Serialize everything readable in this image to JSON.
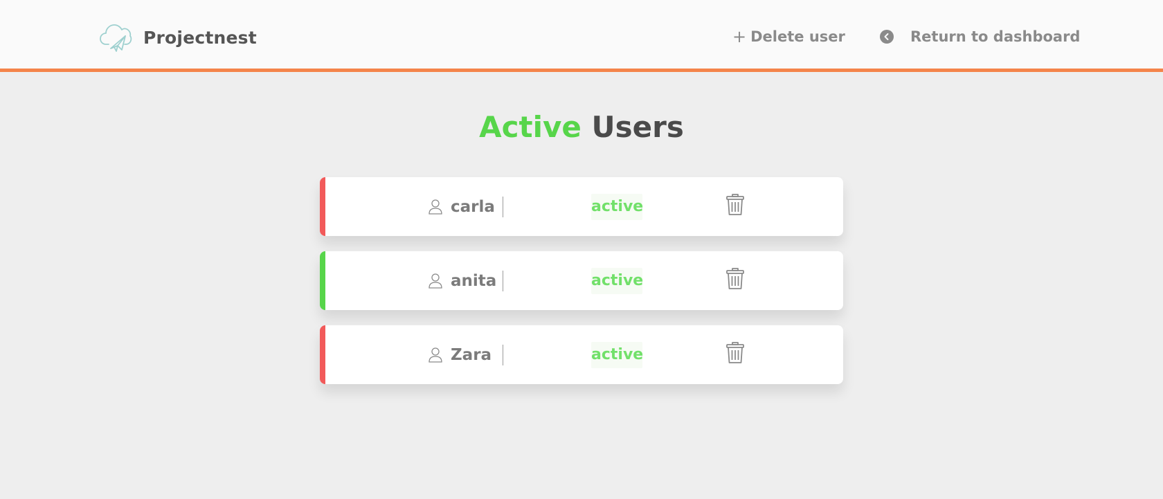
{
  "header": {
    "brand_name": "Projectnest",
    "brand_icon": "cloud-paper-plane-icon",
    "delete_link": {
      "icon": "plus-icon",
      "glyph": "+",
      "label": "Delete user"
    },
    "return_link": {
      "icon": "chevron-left-circle-icon",
      "label": "Return to dashboard"
    },
    "accent_color": "#f4844a"
  },
  "page": {
    "title_accent": "Active",
    "title_rest": "Users",
    "title_accent_color": "#57d54a"
  },
  "users": [
    {
      "name": "carla",
      "status": "active",
      "indicator_color": "#f25a5a"
    },
    {
      "name": "anita",
      "status": "active",
      "indicator_color": "#57d54a"
    },
    {
      "name": "Zara",
      "status": "active",
      "indicator_color": "#f25a5a"
    }
  ],
  "icons": {
    "user": "person-icon",
    "delete": "trash-icon"
  }
}
